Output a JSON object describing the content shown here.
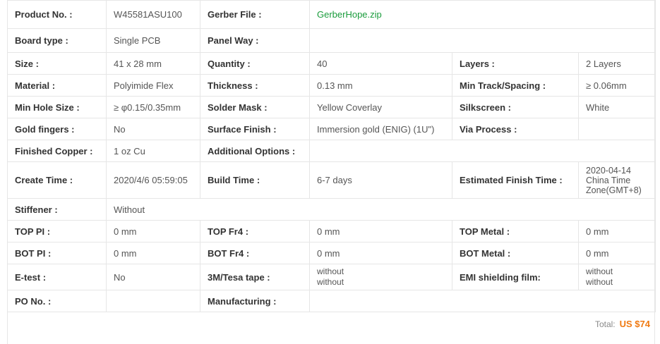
{
  "rows": {
    "r1": {
      "c1l": "Product No. :",
      "c1v": "W45581ASU100",
      "c2l": "Gerber File :",
      "c2v": "GerberHope.zip"
    },
    "r2": {
      "c1l": "Board type :",
      "c1v": "Single PCB",
      "c2l": "Panel Way :",
      "c2v": ""
    },
    "r3": {
      "c1l": "Size :",
      "c1v": "41 x 28 mm",
      "c2l": "Quantity :",
      "c2v": "40",
      "c3l": "Layers :",
      "c3v": "2 Layers"
    },
    "r4": {
      "c1l": "Material :",
      "c1v": "Polyimide Flex",
      "c2l": "Thickness :",
      "c2v": "0.13 mm",
      "c3l": "Min Track/Spacing :",
      "c3v": "≥ 0.06mm"
    },
    "r5": {
      "c1l": "Min Hole Size :",
      "c1v": "≥ φ0.15/0.35mm",
      "c2l": "Solder Mask :",
      "c2v": "Yellow Coverlay",
      "c3l": "Silkscreen :",
      "c3v": "White"
    },
    "r6": {
      "c1l": "Gold fingers :",
      "c1v": "No",
      "c2l": "Surface Finish :",
      "c2v": "Immersion gold (ENIG) (1U\")",
      "c3l": "Via Process :",
      "c3v": ""
    },
    "r7": {
      "c1l": "Finished Copper :",
      "c1v": "1 oz Cu",
      "c2l": "Additional Options :",
      "c2v": ""
    },
    "r8": {
      "c1l": "Create Time :",
      "c1v": "2020/4/6 05:59:05",
      "c2l": "Build Time :",
      "c2v": "6-7 days",
      "c3l": "Estimated Finish Time :",
      "c3v_lines": [
        "2020-04-14",
        "China Time",
        "Zone(GMT+8)"
      ]
    },
    "r9": {
      "c1l": "Stiffener :",
      "c1v": "Without"
    },
    "r10": {
      "c1l": "TOP PI :",
      "c1v": "0 mm",
      "c2l": "TOP Fr4 :",
      "c2v": "0 mm",
      "c3l": "TOP Metal :",
      "c3v": "0 mm"
    },
    "r11": {
      "c1l": "BOT PI :",
      "c1v": "0 mm",
      "c2l": "BOT Fr4 :",
      "c2v": "0 mm",
      "c3l": "BOT Metal :",
      "c3v": "0 mm"
    },
    "r12": {
      "c1l": "E-test :",
      "c1v": "No",
      "c2l": "3M/Tesa tape :",
      "c2v_lines": [
        "without",
        "without"
      ],
      "c3l": "EMI shielding film:",
      "c3v_lines": [
        "without",
        "without"
      ]
    },
    "r13": {
      "c1l": "PO No. :",
      "c1v": "",
      "c2l": "Manufacturing :",
      "c2v": ""
    }
  },
  "total": {
    "label": "Total:",
    "amount": "US $74"
  },
  "colors": {
    "link": "#1a9c3c",
    "total_amount": "#f07a12",
    "border": "#e6e6e6"
  }
}
